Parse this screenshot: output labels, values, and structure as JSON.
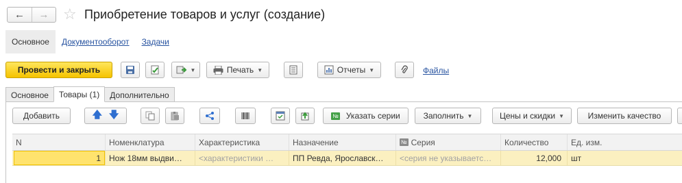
{
  "window": {
    "title": "Приобретение товаров и услуг (создание)"
  },
  "sections": [
    "Основное",
    "Документооборот",
    "Задачи"
  ],
  "toolbar": {
    "post_close": "Провести и закрыть",
    "print": "Печать",
    "reports": "Отчеты",
    "files": "Файлы"
  },
  "tabs": [
    "Основное",
    "Товары (1)",
    "Дополнительно"
  ],
  "table_toolbar": {
    "add": "Добавить",
    "series_badge": "№",
    "specify_series": "Указать серии",
    "fill": "Заполнить",
    "prices": "Цены и скидки",
    "change_quality": "Изменить качество"
  },
  "table": {
    "columns": [
      "N",
      "Номенклатура",
      "Характеристика",
      "Назначение",
      "Серия",
      "Количество",
      "Ед. изм."
    ],
    "series_header_badge": "№",
    "rows": [
      {
        "n": "1",
        "item": "Нож 18мм выдви…",
        "characteristic": "<характеристики …",
        "purpose": "ПП Ревда, Ярославск…",
        "series": "<серия не указываетс…",
        "quantity": "12,000",
        "unit": "шт"
      }
    ]
  },
  "colors": {
    "accent_yellow": "#f5c300",
    "link": "#2753a0",
    "row_selected": "#fbf0c0"
  }
}
